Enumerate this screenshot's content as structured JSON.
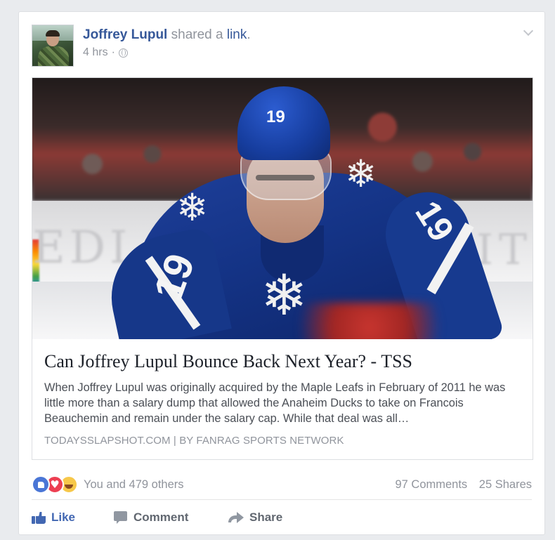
{
  "post": {
    "author": "Joffrey Lupul",
    "action_text": "shared a",
    "link_word": "link",
    "punctuation": ".",
    "time": "4 hrs",
    "time_separator": "·",
    "privacy_icon": "globe-icon",
    "menu_icon": "chevron-down-icon"
  },
  "link_preview": {
    "image_alt": "Hockey player in blue Toronto Maple Leafs jersey number 19",
    "jersey_number": "19",
    "title": "Can Joffrey Lupul Bounce Back Next Year? - TSS",
    "description": "When Joffrey Lupul was originally acquired by the Maple Leafs in February of 2011 he was little more than a salary dump that allowed the Anaheim Ducks to take on Francois Beauchemin and remain under the salary cap. While that deal was all…",
    "source": "TODAYSSLAPSHOT.COM",
    "source_separator": "|",
    "source_by": "BY FANRAG SPORTS NETWORK"
  },
  "stats": {
    "reaction_icons": [
      "like-reaction-icon",
      "love-reaction-icon",
      "haha-reaction-icon"
    ],
    "reaction_text": "You and 479 others",
    "comments": "97 Comments",
    "shares": "25 Shares"
  },
  "actions": {
    "like_label": "Like",
    "comment_label": "Comment",
    "share_label": "Share"
  },
  "colors": {
    "author_blue": "#365899",
    "like_blue": "#4267b2",
    "muted_gray": "#90949c",
    "background": "#e9ebee"
  }
}
